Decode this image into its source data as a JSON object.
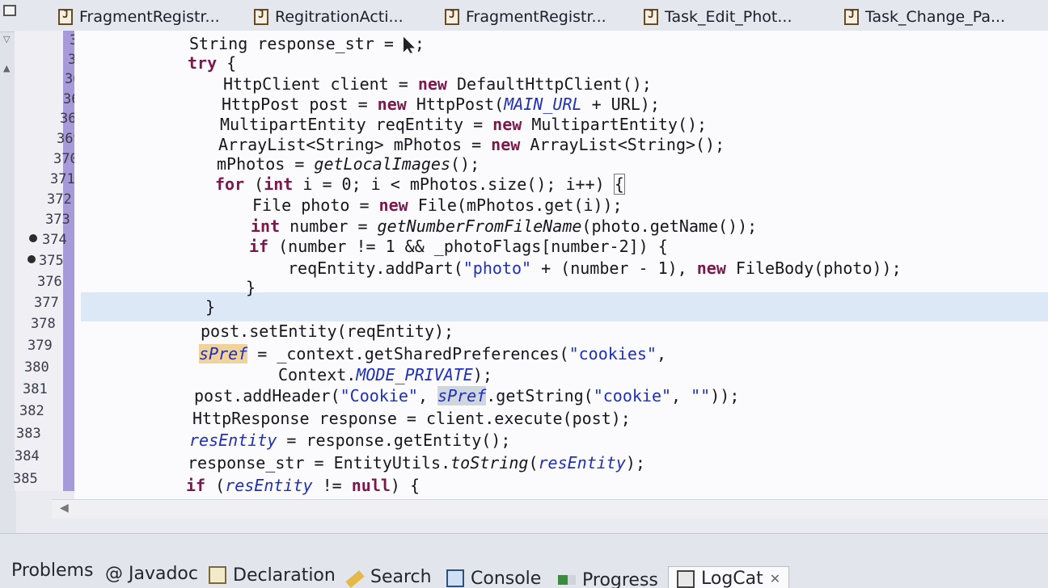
{
  "editor_tabs": [
    {
      "label": "FragmentRegistr..."
    },
    {
      "label": "RegitrationActi..."
    },
    {
      "label": "FragmentRegistr..."
    },
    {
      "label": "Task_Edit_Phot..."
    },
    {
      "label": "Task_Change_Pa..."
    }
  ],
  "line_numbers": [
    "364",
    "365",
    "366",
    "367",
    "368",
    "369",
    "370",
    "371",
    "372",
    "373",
    "374",
    "375",
    "376",
    "377",
    "378",
    "379",
    "380",
    "381",
    "382",
    "383",
    "384",
    "385"
  ],
  "code": {
    "l364": [
      "String response_str = ",
      ";"
    ],
    "l365": [
      "try",
      " {"
    ],
    "l366": [
      "HttpClient client = ",
      "new",
      " DefaultHttpClient();"
    ],
    "l367": [
      "HttpPost post = ",
      "new",
      " HttpPost(",
      "MAIN_URL",
      " + URL);"
    ],
    "l368": [
      "MultipartEntity reqEntity = ",
      "new",
      " MultipartEntity();"
    ],
    "l369": [
      "ArrayList<String> mPhotos = ",
      "new",
      " ArrayList<String>();"
    ],
    "l370": [
      "mPhotos = ",
      "getLocalImages",
      "();"
    ],
    "l371": [
      "for",
      " (",
      "int",
      " i = 0; i < mPhotos.size(); i++) ",
      "{"
    ],
    "l372": [
      "File photo = ",
      "new",
      " File(mPhotos.get(i));"
    ],
    "l373": [
      "int",
      " number = ",
      "getNumberFromFileName",
      "(photo.getName());"
    ],
    "l374": [
      "if",
      " (number != 1 && _photoFlags[number-2]) {"
    ],
    "l375": [
      "reqEntity.addPart(",
      "\"photo\"",
      " + (number - 1), ",
      "new",
      " FileBody(photo));"
    ],
    "l376": [
      "}"
    ],
    "l377": [
      "}"
    ],
    "l378": [
      "post.setEntity(reqEntity);"
    ],
    "l379": [
      "sPref",
      " = _context.getSharedPreferences(",
      "\"cookies\"",
      ","
    ],
    "l380": [
      "Context.",
      "MODE_PRIVATE",
      ");"
    ],
    "l381": [
      "post.addHeader(",
      "\"Cookie\"",
      ", ",
      "sPref",
      ".getString(",
      "\"cookie\"",
      ", ",
      "\"\"",
      "));"
    ],
    "l382": [
      "HttpResponse response = client.execute(post);"
    ],
    "l383": [
      "resEntity",
      " = response.getEntity();"
    ],
    "l384": [
      "response_str = EntityUtils.",
      "toString",
      "(",
      "resEntity",
      ");"
    ],
    "l385": [
      "if",
      " (",
      "resEntity",
      " != ",
      "null",
      ") {"
    ]
  },
  "bottom_tabs": [
    {
      "label": "Problems",
      "icon": "problems-icon"
    },
    {
      "label": "@ Javadoc",
      "icon": "javadoc-icon"
    },
    {
      "label": "Declaration",
      "icon": "declaration-icon"
    },
    {
      "label": "Search",
      "icon": "search-icon"
    },
    {
      "label": "Console",
      "icon": "console-icon"
    },
    {
      "label": "Progress",
      "icon": "progress-icon"
    },
    {
      "label": "LogCat",
      "icon": "logcat-icon",
      "active": true
    }
  ],
  "colors": {
    "keyword": "#7a1a4a",
    "string": "#1f2fb8",
    "current_line": "#dde8f6",
    "occurrence": "#f0d29a",
    "ruler": "#a79ad8"
  }
}
